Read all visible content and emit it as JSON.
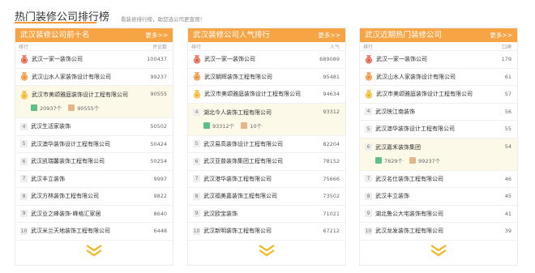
{
  "header": {
    "title": "热门装修公司排行榜",
    "subtitle": "看装修排行榜，助您选公司更直观！"
  },
  "panels": [
    {
      "title": "武汉装修公司前十名",
      "more": "更多>>",
      "col_rank": "排行",
      "col_value": "评论数",
      "rows": [
        {
          "rank": "1",
          "name": "武汉一家一装饰公司",
          "value": "100437"
        },
        {
          "rank": "2",
          "name": "武汉山水人家装饰设计有限公司",
          "value": "99237"
        },
        {
          "rank": "3",
          "name": "武汉市美颂雅庭装饰设计工程有限公司",
          "value": "90555",
          "stat1": "20937个",
          "stat2": "90555个"
        },
        {
          "rank": "4",
          "name": "武汉生活家装饰",
          "value": "50502"
        },
        {
          "rank": "5",
          "name": "武汉澳华装饰设计工程有限公司",
          "value": "50424"
        },
        {
          "rank": "6",
          "name": "武汉凯瑞馨装饰工程有限公司",
          "value": "50254"
        },
        {
          "rank": "7",
          "name": "武汉丰立装饰",
          "value": "9997"
        },
        {
          "rank": "8",
          "name": "武汉方林装饰工程有限公司",
          "value": "9822"
        },
        {
          "rank": "9",
          "name": "武汉业之峰装饰-峰格汇家居",
          "value": "8640"
        },
        {
          "rank": "10",
          "name": "武汉米兰天地装饰工程有限公司",
          "value": "6448"
        }
      ]
    },
    {
      "title": "武汉装修公司人气排行",
      "more": "更多>>",
      "col_rank": "排行",
      "col_value": "人气",
      "rows": [
        {
          "rank": "1",
          "name": "武汉一家一装饰公司",
          "value": "689089"
        },
        {
          "rank": "2",
          "name": "武汉朝辉装饰工程有限公司",
          "value": "95481"
        },
        {
          "rank": "3",
          "name": "武汉市美颂雅庭装饰设计工程有限公司",
          "value": "94634"
        },
        {
          "rank": "4",
          "name": "湖北今人装饰工程有限公司",
          "value": "93312",
          "stat1": "93312个",
          "stat2": "10个"
        },
        {
          "rank": "5",
          "name": "武汉易高装饰设计工程有限公司",
          "value": "82204"
        },
        {
          "rank": "6",
          "name": "武汉亚普装饰集团工程有限公司",
          "value": "78152"
        },
        {
          "rank": "7",
          "name": "武汉港华装饰工程有限公司",
          "value": "75666"
        },
        {
          "rank": "8",
          "name": "武汉福美嘉装饰工程有限公司",
          "value": "73502"
        },
        {
          "rank": "9",
          "name": "武汉欧宝装饰",
          "value": "71021"
        },
        {
          "rank": "10",
          "name": "武汉新明装饰工程有限公司",
          "value": "67212"
        }
      ]
    },
    {
      "title": "武汉近期热门装修公司",
      "more": "更多>>",
      "col_rank": "排行",
      "col_value": "口碑",
      "rows": [
        {
          "rank": "1",
          "name": "武汉一家一装饰公司",
          "value": "179"
        },
        {
          "rank": "2",
          "name": "武汉山水人家装饰设计有限公司",
          "value": "61"
        },
        {
          "rank": "3",
          "name": "武汉市美颂雅庭装饰设计工程有限公司",
          "value": "57"
        },
        {
          "rank": "4",
          "name": "武汉映江南装饰",
          "value": "56"
        },
        {
          "rank": "5",
          "name": "武汉澳华装饰设计工程有限公司",
          "value": "55"
        },
        {
          "rank": "6",
          "name": "武汉嘉禾装饰集团",
          "value": "54",
          "stat1": "7829个",
          "stat2": "99237个"
        },
        {
          "rank": "7",
          "name": "武汉名仕装饰工程有限公司",
          "value": "46"
        },
        {
          "rank": "8",
          "name": "武汉丰立装饰",
          "value": "45"
        },
        {
          "rank": "9",
          "name": "湖北鲁公大宅装饰有限公司",
          "value": "41"
        },
        {
          "rank": "10",
          "name": "武汉龙发装饰工程有限公司",
          "value": "39"
        }
      ]
    }
  ],
  "colors": {
    "accent": "#f6a444",
    "gold_medal": "#f3b51d",
    "red_medal": "#e8553c",
    "orange_medal": "#f08a2c",
    "highlight_bg": "#fdf9e9"
  },
  "icons": [
    "medal-icon",
    "comment-count-icon",
    "case-count-icon",
    "chevron-down-icon"
  ]
}
